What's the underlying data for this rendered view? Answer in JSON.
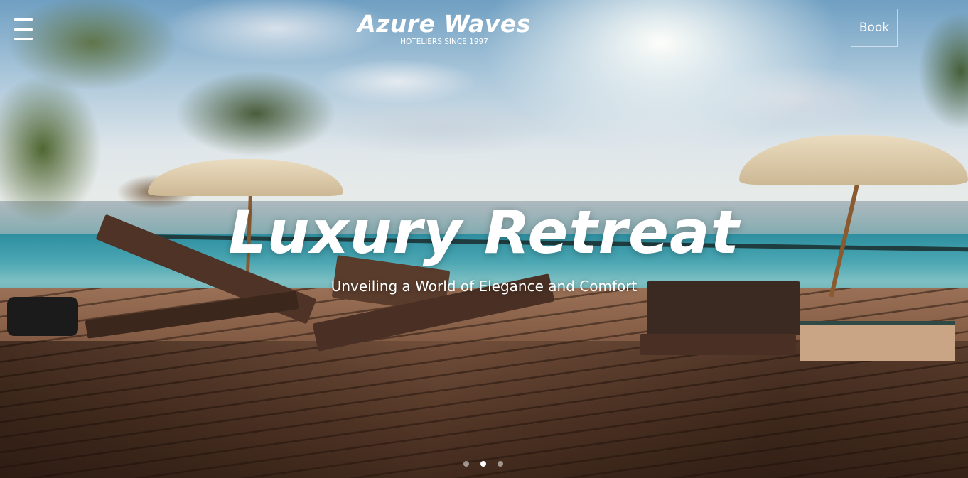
{
  "header": {
    "menu_icon": "hamburger-menu-icon",
    "brand_name": "Azure Waves",
    "brand_tagline": "HOTELIERS SINCE 1997",
    "book_label": "Book"
  },
  "hero": {
    "title": "Luxury Retreat",
    "subtitle": "Unveiling a World of Elegance and Comfort",
    "slides_count": 3,
    "active_slide": 2
  },
  "colors": {
    "text": "#ffffff",
    "dot_inactive": "#bfbfbf",
    "dot_active": "#ffffff"
  }
}
